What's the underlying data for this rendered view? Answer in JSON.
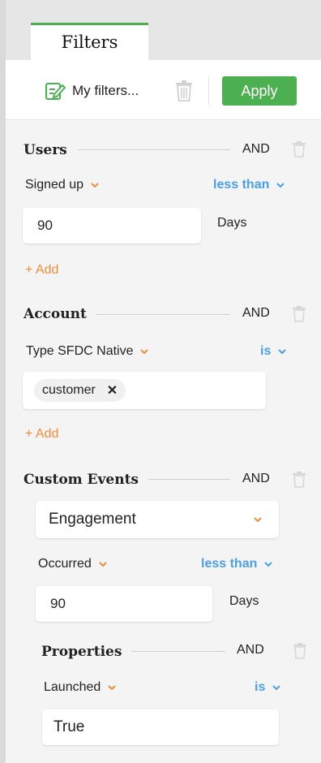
{
  "tab": {
    "label": "Filters"
  },
  "toolbar": {
    "my_filters_label": "My filters...",
    "apply_label": "Apply"
  },
  "colors": {
    "accent_green": "#4caf50",
    "orange": "#f08c3a",
    "blue": "#4a9fe6"
  },
  "users": {
    "title": "Users",
    "logic": "AND",
    "field": "Signed up",
    "operator": "less than",
    "value": "90",
    "unit": "Days",
    "add_label": "+ Add"
  },
  "account": {
    "title": "Account",
    "logic": "AND",
    "field": "Type SFDC Native",
    "operator": "is",
    "chip": "customer",
    "add_label": "+ Add"
  },
  "custom_events": {
    "title": "Custom Events",
    "logic": "AND",
    "event": "Engagement",
    "field": "Occurred",
    "operator": "less than",
    "value": "90",
    "unit": "Days",
    "properties": {
      "title": "Properties",
      "logic": "AND",
      "field": "Launched",
      "operator": "is",
      "value": "True"
    }
  }
}
